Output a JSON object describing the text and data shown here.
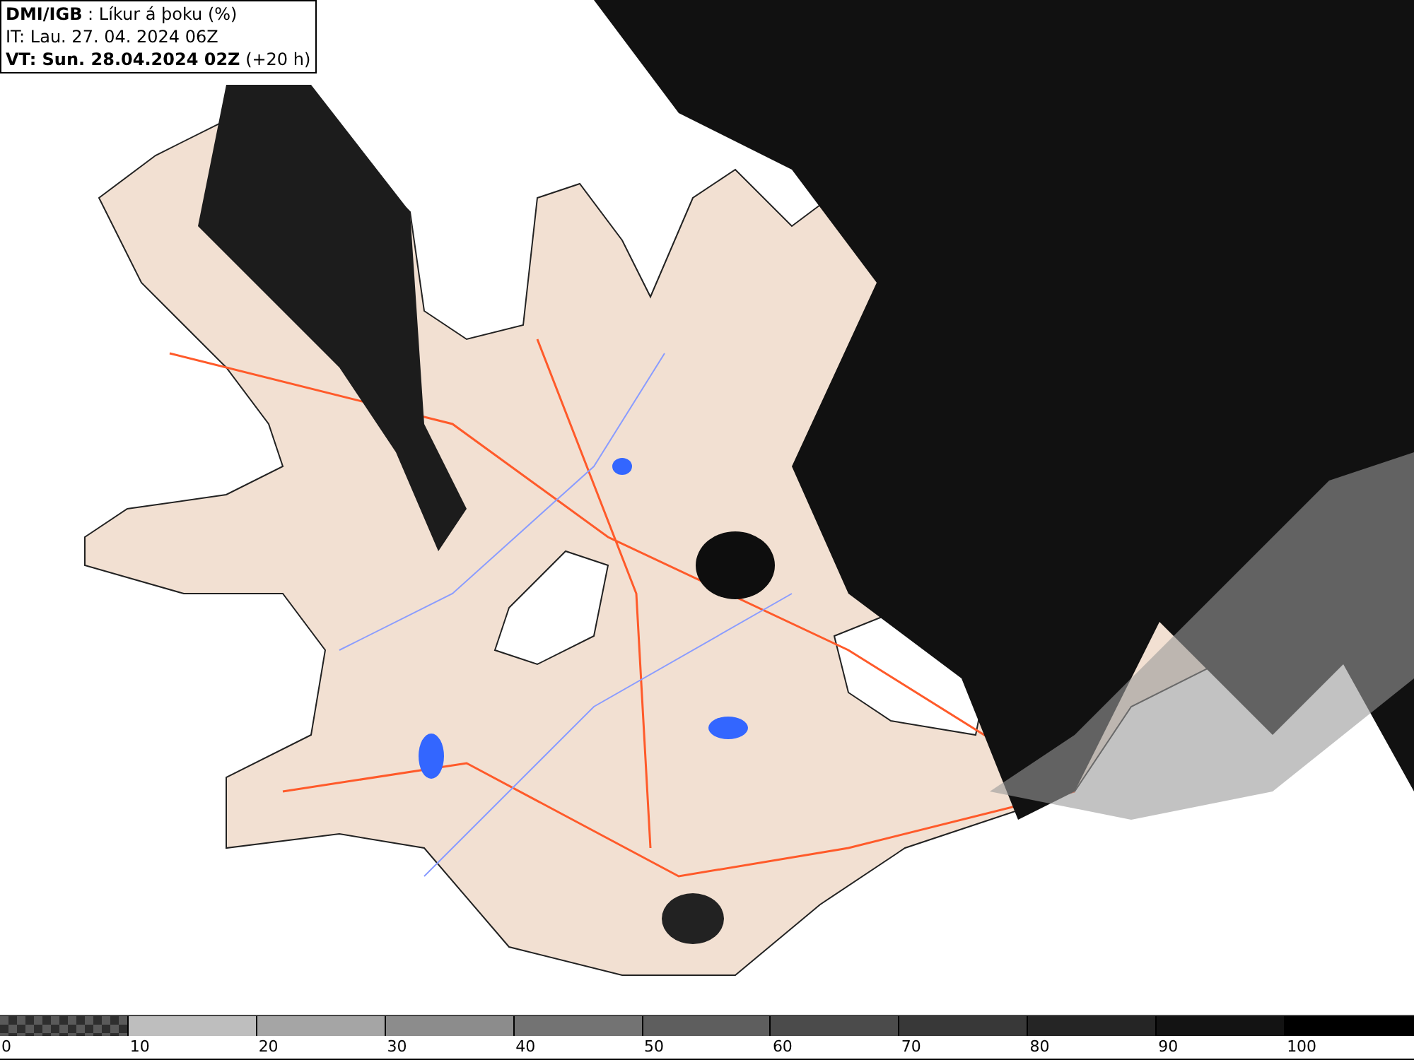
{
  "header": {
    "lines": [
      "**DMI/IGB** : Líkur á þoku (%)",
      "IT: Lau. 27. 04. 2024 06Z",
      "**VT: Sun. 28.04.2024 02Z** (+20 h)"
    ]
  },
  "legend": [
    {
      "label": "0",
      "kind": "pattern",
      "color": "#5a5a5a"
    },
    {
      "label": "10",
      "kind": "solid",
      "color": "#bebebe"
    },
    {
      "label": "20",
      "kind": "solid",
      "color": "#a5a5a5"
    },
    {
      "label": "30",
      "kind": "solid",
      "color": "#8c8c8c"
    },
    {
      "label": "40",
      "kind": "solid",
      "color": "#737373"
    },
    {
      "label": "50",
      "kind": "solid",
      "color": "#5e5e5e"
    },
    {
      "label": "60",
      "kind": "solid",
      "color": "#4b4b4b"
    },
    {
      "label": "70",
      "kind": "solid",
      "color": "#383838"
    },
    {
      "label": "80",
      "kind": "solid",
      "color": "#252525"
    },
    {
      "label": "90",
      "kind": "solid",
      "color": "#131313"
    },
    {
      "label": "100",
      "kind": "solid",
      "color": "#000000"
    }
  ]
}
